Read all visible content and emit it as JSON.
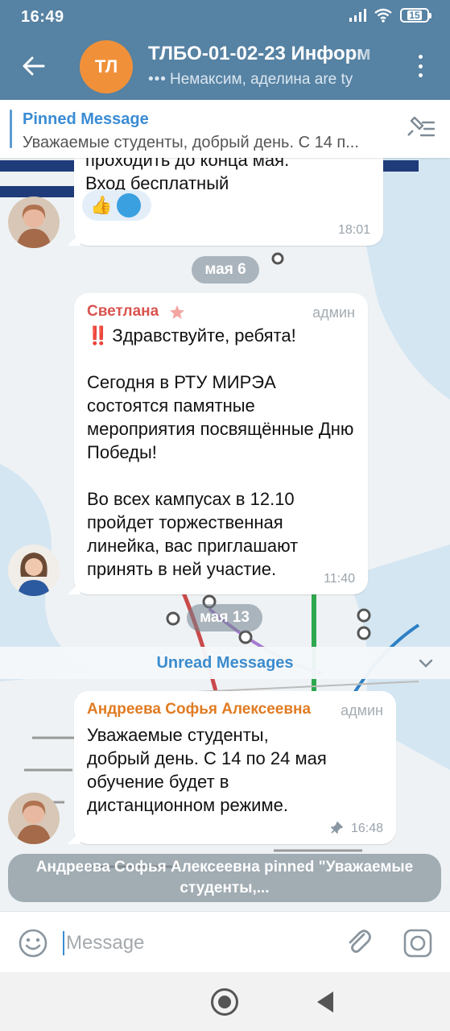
{
  "status_bar": {
    "time": "16:49",
    "battery": "15"
  },
  "header": {
    "avatar_initials": "ТЛ",
    "title": "ТЛБО-01-02-23 Информ",
    "subtitle": "Немаксим, аделина are ty"
  },
  "pinned": {
    "title": "Pinned Message",
    "text": "Уважаемые студенты, добрый день. С 14 п..."
  },
  "messages": [
    {
      "text": "проходить до конца мая.\nВход бесплатный",
      "reactions": [
        "👍",
        "🔵"
      ],
      "time": "18:01"
    },
    {
      "sender": "Светлана",
      "role": "админ",
      "emoji": "‼️",
      "text": "Здравствуйте, ребята!\n\nСегодня в РТУ МИРЭА состоятся памятные мероприятия посвящённые Дню Победы!\n\nВо всех кампусах в 12.10 пройдет торжественная линейка, вас приглашают принять в ней участие.",
      "time": "11:40"
    },
    {
      "sender": "Андреева Софья Алексеевна",
      "role": "админ",
      "text": "Уважаемые студенты, добрый день. С 14 по 24 мая обучение будет в дистанционном режиме.",
      "time": "16:48"
    }
  ],
  "dates": {
    "d1": "мая 6",
    "d2": "мая 13"
  },
  "unread_label": "Unread Messages",
  "service_message": "Андреева Софья Алексеевна pinned \"Уважаемые студенты,...",
  "input": {
    "placeholder": "Message"
  },
  "colors": {
    "header": "#5682a3",
    "accent": "#3a8cd4",
    "sender1": "#d9534f",
    "sender2": "#e07b22"
  }
}
